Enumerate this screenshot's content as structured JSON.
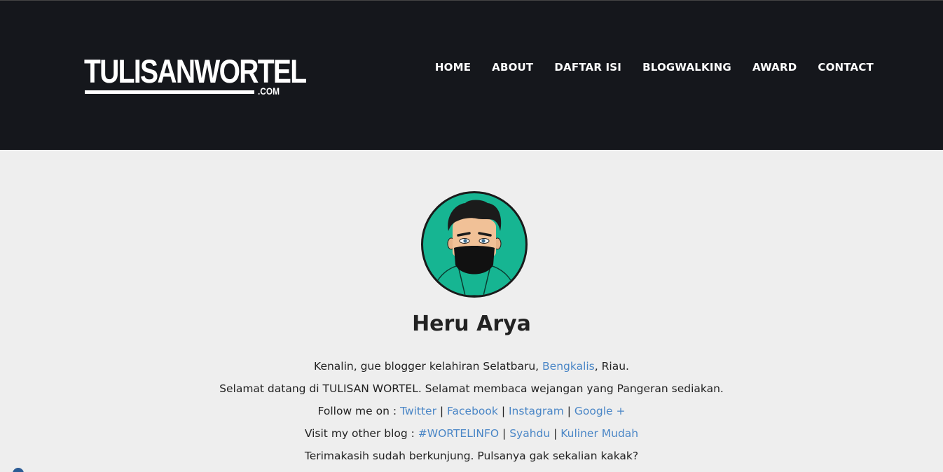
{
  "brand": {
    "logo_text": "TULISANWORTEL",
    "logo_tld": ".COM"
  },
  "nav": {
    "items": [
      {
        "label": "HOME"
      },
      {
        "label": "ABOUT"
      },
      {
        "label": "DAFTAR ISI"
      },
      {
        "label": "BLOGWALKING"
      },
      {
        "label": "AWARD"
      },
      {
        "label": "CONTACT"
      }
    ]
  },
  "profile": {
    "name": "Heru Arya",
    "avatar_icon": "masked-man-avatar",
    "colors": {
      "avatar_bg": "#16b592",
      "link": "#4a86c6",
      "header_bg": "#15171c",
      "page_bg": "#eeeeee"
    }
  },
  "bio": {
    "line1": {
      "before": "Kenalin, gue blogger kelahiran Selatbaru, ",
      "link": "Bengkalis",
      "after": ", Riau."
    },
    "line2": "Selamat datang di TULISAN WORTEL. Selamat membaca wejangan yang Pangeran sediakan.",
    "line3": {
      "prefix": "Follow me on : ",
      "links": [
        "Twitter",
        "Facebook",
        "Instagram",
        "Google +"
      ],
      "separator": " | "
    },
    "line4": {
      "prefix": "Visit my other blog : ",
      "links": [
        "#WORTELINFO",
        "Syahdu",
        "Kuliner Mudah"
      ],
      "separator": " | "
    },
    "line5": "Terimakasih sudah berkunjung. Pulsanya gak sekalian kakak?"
  }
}
